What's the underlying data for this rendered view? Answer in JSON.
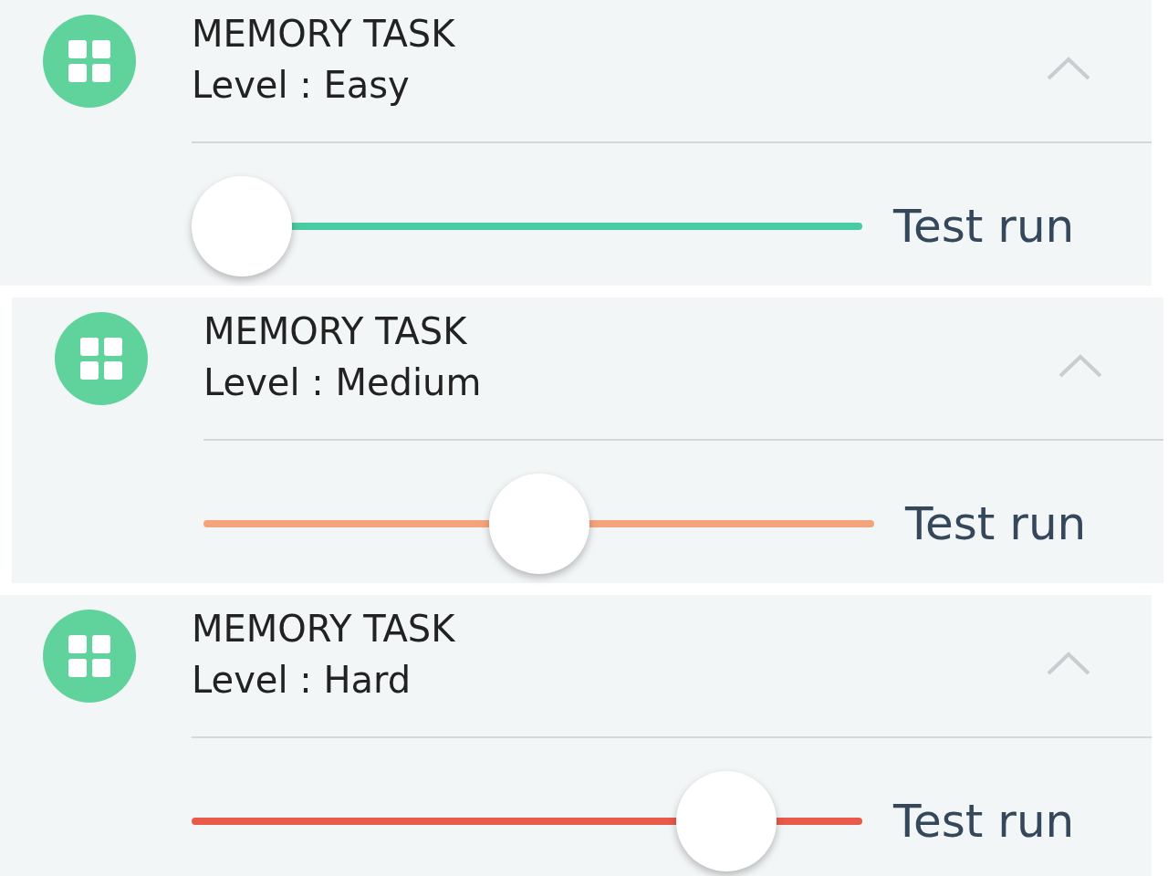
{
  "tasks": [
    {
      "title": "MEMORY TASK",
      "level_text": "Level : Easy",
      "expanded": true,
      "level": 0,
      "color": "#48cba0",
      "action": "Test run"
    },
    {
      "title": "MEMORY TASK",
      "level_text": "Level : Medium",
      "expanded": true,
      "level": 0.5,
      "color": "#f4a47c",
      "action": "Test run"
    },
    {
      "title": "MEMORY TASK",
      "level_text": "Level : Hard",
      "expanded": true,
      "level": 0.85,
      "color": "#e95a4a",
      "action": "Test run"
    }
  ]
}
